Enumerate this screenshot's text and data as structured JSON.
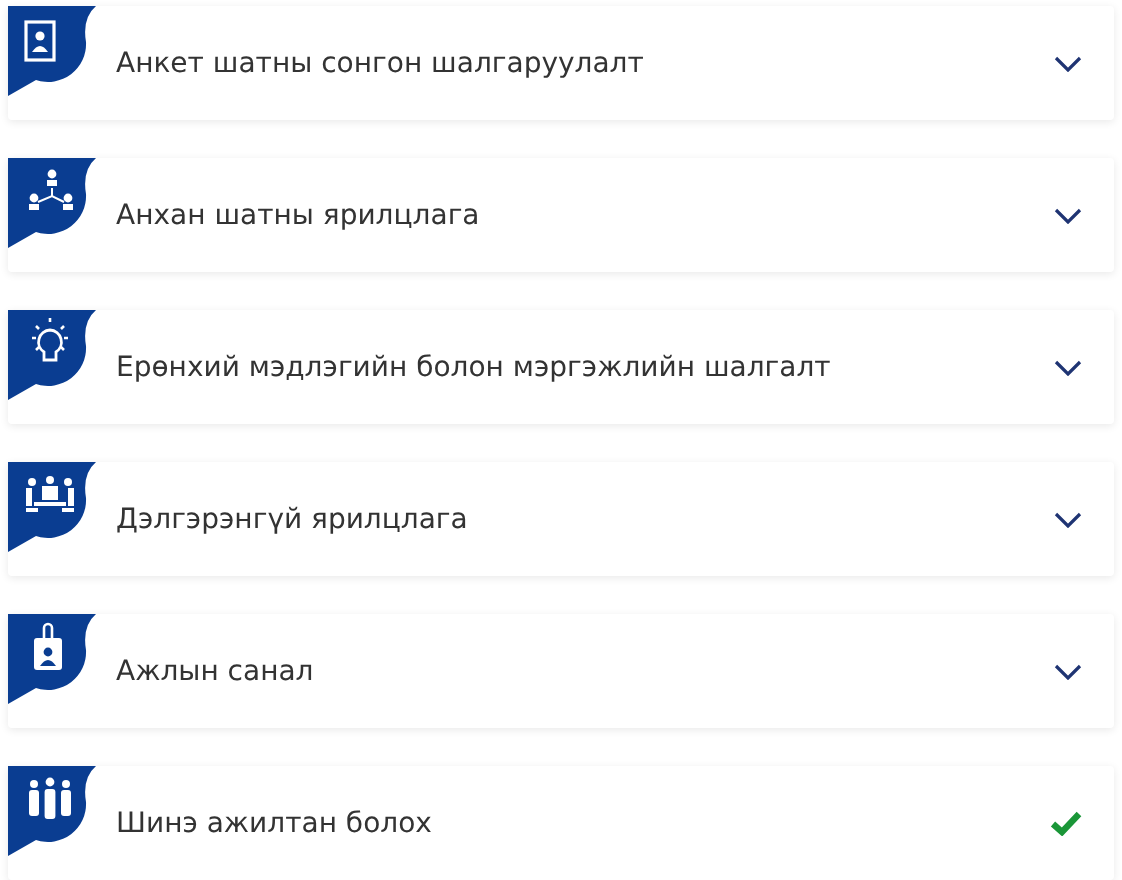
{
  "steps": [
    {
      "title": "Анкет шатны сонгон шалгаруулалт",
      "kind": "pending"
    },
    {
      "title": "Анхан шатны ярилцлага",
      "kind": "pending"
    },
    {
      "title": "Ерөнхий мэдлэгийн болон мэргэжлийн шалгалт",
      "kind": "pending"
    },
    {
      "title": "Дэлгэрэнгүй ярилцлага",
      "kind": "pending"
    },
    {
      "title": "Ажлын санал",
      "kind": "pending"
    },
    {
      "title": "Шинэ ажилтан болох",
      "kind": "done"
    }
  ]
}
